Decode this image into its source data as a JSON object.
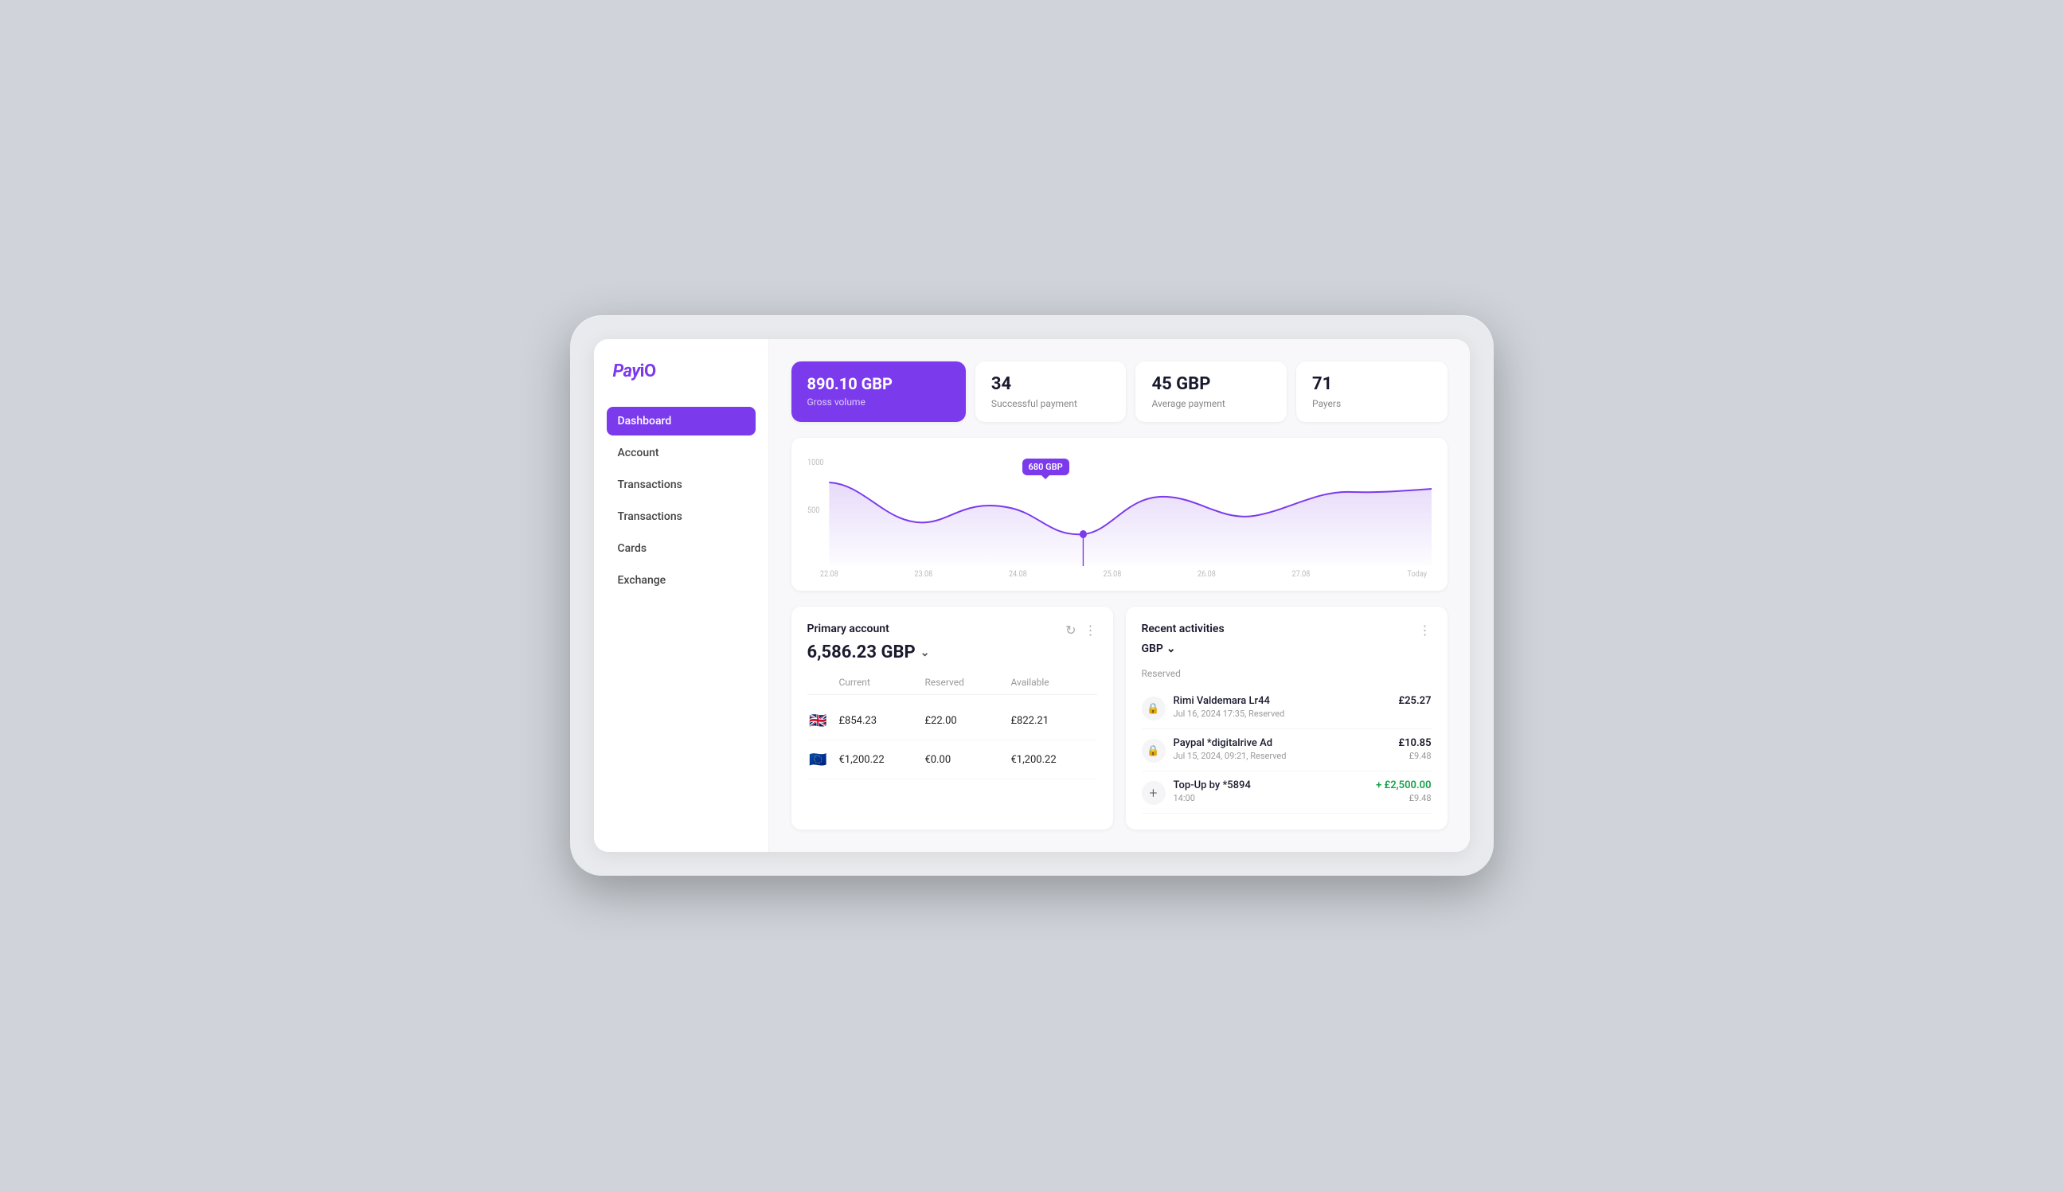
{
  "app": {
    "logo": "PayiO"
  },
  "sidebar": {
    "items": [
      {
        "id": "dashboard",
        "label": "Dashboard",
        "active": true
      },
      {
        "id": "account",
        "label": "Account",
        "active": false
      },
      {
        "id": "transactions1",
        "label": "Transactions",
        "active": false
      },
      {
        "id": "transactions2",
        "label": "Transactions",
        "active": false
      },
      {
        "id": "cards",
        "label": "Cards",
        "active": false
      },
      {
        "id": "exchange",
        "label": "Exchange",
        "active": false
      }
    ]
  },
  "stats": {
    "gross_volume_value": "890.10 GBP",
    "gross_volume_label": "Gross volume",
    "successful_payment_value": "34",
    "successful_payment_label": "Successful payment",
    "average_payment_value": "45 GBP",
    "average_payment_label": "Average payment",
    "payers_value": "71",
    "payers_label": "Payers"
  },
  "chart": {
    "tooltip_label": "680 GBP",
    "x_labels": [
      "22.08",
      "23.08",
      "24.08",
      "25.08",
      "26.08",
      "27.08",
      "Today"
    ],
    "y_labels": [
      "1000",
      "500"
    ]
  },
  "primary_account": {
    "title": "Primary account",
    "balance": "6,586.23 GBP",
    "columns": {
      "current": "Current",
      "reserved": "Reserved",
      "available": "Available"
    },
    "rows": [
      {
        "flag": "🇬🇧",
        "current": "£854.23",
        "reserved": "£22.00",
        "available": "£822.21"
      },
      {
        "flag": "🇪🇺",
        "current": "€1,200.22",
        "reserved": "€0.00",
        "available": "€1,200.22"
      }
    ]
  },
  "recent_activities": {
    "title": "Recent activities",
    "currency": "GBP",
    "section_label": "Reserved",
    "items": [
      {
        "icon": "lock",
        "name": "Rimi Valdemara Lr44",
        "date": "Jul 16, 2024 17:35, Reserved",
        "amount": "£25.27",
        "amount_sub": "",
        "positive": false
      },
      {
        "icon": "lock",
        "name": "Paypal *digitalrive Ad",
        "date": "Jul 15, 2024, 09:21, Reserved",
        "amount": "£10.85",
        "amount_sub": "£9.48",
        "positive": false
      },
      {
        "icon": "plus",
        "name": "Top-Up by *5894",
        "date": "14:00",
        "amount": "+ £2,500.00",
        "amount_sub": "£9.48",
        "positive": true
      }
    ]
  }
}
